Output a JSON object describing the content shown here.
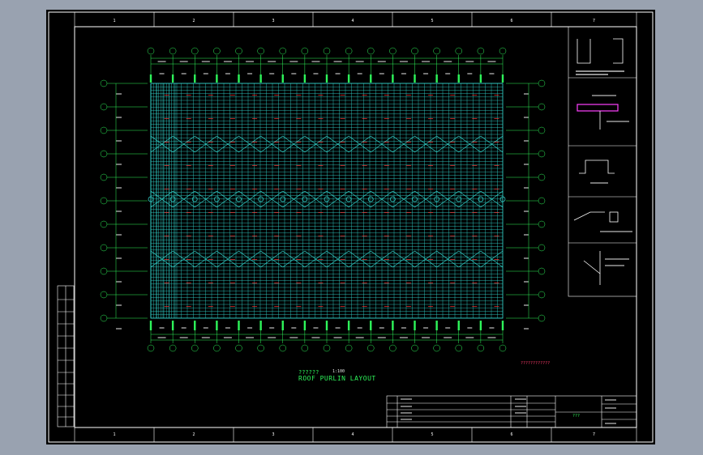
{
  "drawing": {
    "title_cn": "??????",
    "title_en": "ROOF PURLIN LAYOUT",
    "scale": "1:100",
    "note": "????????????",
    "project_label": "???"
  },
  "plan": {
    "grid_cols": 16,
    "grid_rows": 10,
    "purlin_color": "#36e0d8",
    "axis_color": "#2ef55a",
    "bracing_color": "#ff3030"
  },
  "border": {
    "zone_numbers": [
      "1",
      "2",
      "3",
      "4",
      "5",
      "6",
      "7"
    ]
  },
  "colors": {
    "background": "#000000",
    "frame": "#ffffff",
    "desktop": "#99a2b0",
    "highlight": "#ff40ff"
  }
}
